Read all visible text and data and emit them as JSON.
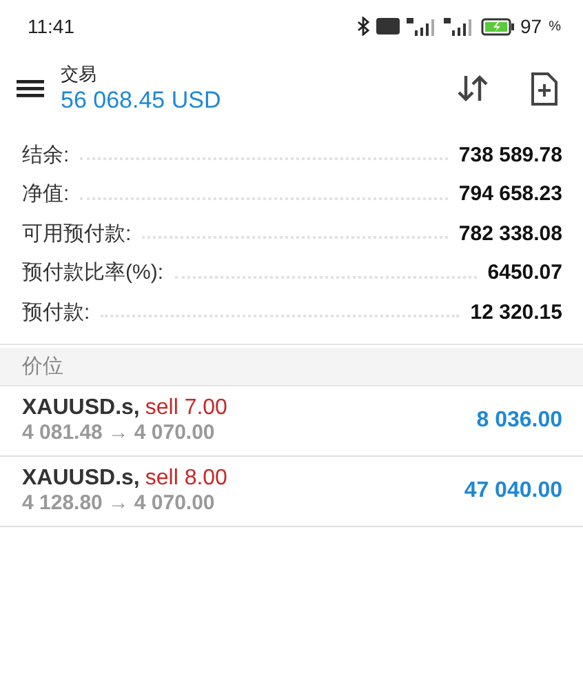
{
  "status_bar": {
    "time": "11:41",
    "battery": "97",
    "battery_unit": "%"
  },
  "header": {
    "title": "交易",
    "balance": "56 068.45 USD"
  },
  "summary": [
    {
      "label": "结余:",
      "value": "738 589.78"
    },
    {
      "label": "净值:",
      "value": "794 658.23"
    },
    {
      "label": "可用预付款:",
      "value": "782 338.08"
    },
    {
      "label": "预付款比率(%):",
      "value": "6450.07"
    },
    {
      "label": "预付款:",
      "value": "12 320.15"
    }
  ],
  "section": {
    "title": "价位"
  },
  "positions": [
    {
      "symbol": "XAUUSD.s,",
      "kind": "sell",
      "order": "sell 7.00",
      "open_price": "4 081.48",
      "arrow": "→",
      "current_price": "4 070.00",
      "profit": "8 036.00"
    },
    {
      "symbol": "XAUUSD.s,",
      "kind": "sell",
      "order": "sell 8.00",
      "open_price": "4 128.80",
      "arrow": "→",
      "current_price": "4 070.00",
      "profit": "47 040.00"
    }
  ]
}
